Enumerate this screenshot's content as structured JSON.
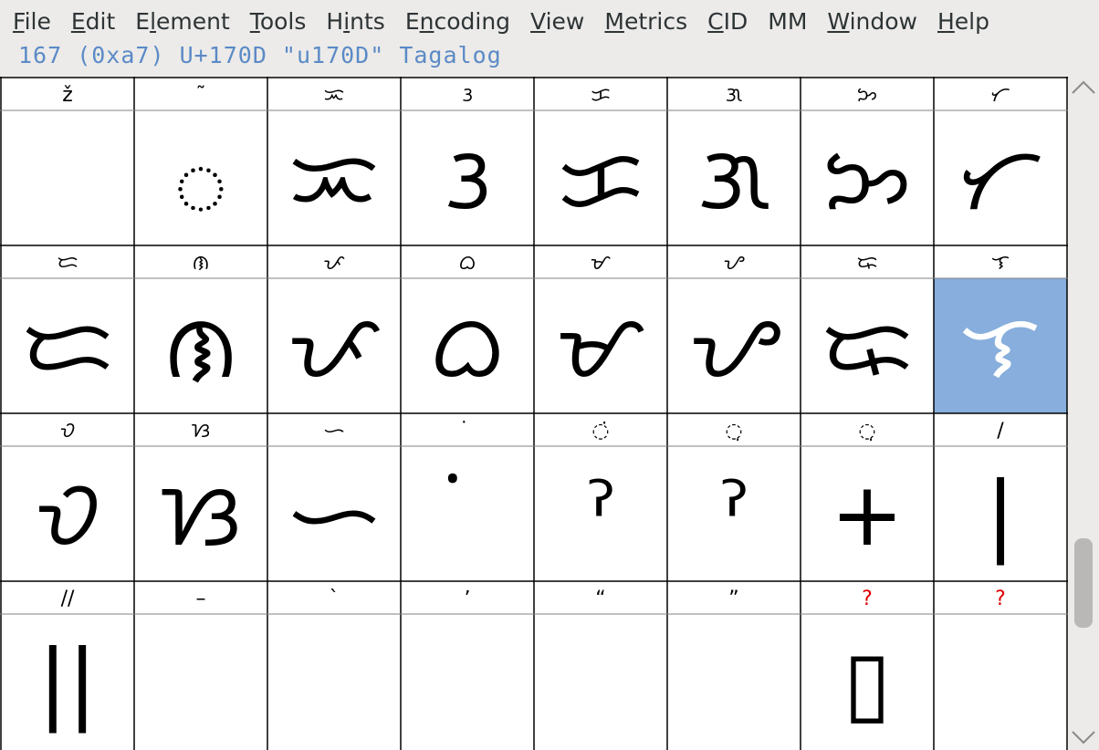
{
  "menu": [
    {
      "key": "file",
      "pre": "",
      "acc": "F",
      "post": "ile"
    },
    {
      "key": "edit",
      "pre": "",
      "acc": "E",
      "post": "dit"
    },
    {
      "key": "element",
      "pre": "E",
      "acc": "l",
      "post": "ement"
    },
    {
      "key": "tools",
      "pre": "",
      "acc": "T",
      "post": "ools"
    },
    {
      "key": "hints",
      "pre": "H",
      "acc": "i",
      "post": "nts"
    },
    {
      "key": "encoding",
      "pre": "E",
      "acc": "n",
      "post": "coding"
    },
    {
      "key": "view",
      "pre": "",
      "acc": "V",
      "post": "iew"
    },
    {
      "key": "metrics",
      "pre": "",
      "acc": "M",
      "post": "etrics"
    },
    {
      "key": "cid",
      "pre": "",
      "acc": "C",
      "post": "ID"
    },
    {
      "key": "mm",
      "pre": "MM",
      "acc": "",
      "post": ""
    },
    {
      "key": "window",
      "pre": "",
      "acc": "W",
      "post": "indow"
    },
    {
      "key": "help",
      "pre": "",
      "acc": "H",
      "post": "elp"
    }
  ],
  "info": "167 (0xa7) U+170D \"u170D\" Tagalog",
  "colors": {
    "info_text": "#5b8ac6",
    "selected_cell": "#87aedc",
    "missing_label": "#dd0000"
  },
  "glyph_rows": [
    [
      {
        "label": "ž",
        "glyph": "",
        "name": "zcaron"
      },
      {
        "label": "˜",
        "glyph": "ᜀ",
        "name": "tagalog-a"
      },
      {
        "label": "ᜁ",
        "glyph": "ᜁ",
        "name": "tagalog-i"
      },
      {
        "label": "ᜂ",
        "glyph": "ᜂ",
        "name": "tagalog-u"
      },
      {
        "label": "ᜃ",
        "glyph": "ᜃ",
        "name": "tagalog-ka"
      },
      {
        "label": "ᜄ",
        "glyph": "ᜄ",
        "name": "tagalog-ga"
      },
      {
        "label": "ᜅ",
        "glyph": "ᜅ",
        "name": "tagalog-nga"
      },
      {
        "label": "ᜆ",
        "glyph": "ᜆ",
        "name": "tagalog-ta"
      }
    ],
    [
      {
        "label": "ᜇ",
        "glyph": "ᜇ",
        "name": "tagalog-da"
      },
      {
        "label": "ᜈ",
        "glyph": "ᜈ",
        "name": "tagalog-na"
      },
      {
        "label": "ᜉ",
        "glyph": "ᜉ",
        "name": "tagalog-pa"
      },
      {
        "label": "ᜊ",
        "glyph": "ᜊ",
        "name": "tagalog-ba"
      },
      {
        "label": "ᜋ",
        "glyph": "ᜋ",
        "name": "tagalog-ma"
      },
      {
        "label": "ᜌ",
        "glyph": "ᜌ",
        "name": "tagalog-ya"
      },
      {
        "label": "ᜍ",
        "glyph": "ᜍ",
        "name": "tagalog-ra"
      },
      {
        "label": "ᜎ",
        "glyph": "ᜎ",
        "name": "tagalog-la",
        "selected": true
      }
    ],
    [
      {
        "label": "ᜏ",
        "glyph": "ᜏ",
        "name": "tagalog-wa"
      },
      {
        "label": "ᜐ",
        "glyph": "ᜐ",
        "name": "tagalog-sa"
      },
      {
        "label": "ᜑ",
        "glyph": "ᜑ",
        "name": "tagalog-ha"
      },
      {
        "label": "ᜒ",
        "glyph": "ᜒ",
        "name": "tagalog-i-sign"
      },
      {
        "label": "◌̇",
        "glyph": "ˀ",
        "name": "tagalog-i-mark"
      },
      {
        "label": "◌̣",
        "glyph": "ˀ",
        "name": "tagalog-u-mark"
      },
      {
        "label": "◌̣",
        "glyph": "+",
        "name": "tagalog-virama"
      },
      {
        "label": "/",
        "glyph": "|",
        "name": "danda"
      }
    ],
    [
      {
        "label": "//",
        "glyph": "||",
        "name": "double-danda"
      },
      {
        "label": "–",
        "glyph": "",
        "name": "endash"
      },
      {
        "label": "`",
        "glyph": "",
        "name": "quoteleft"
      },
      {
        "label": "ʼ",
        "glyph": "",
        "name": "quoteright"
      },
      {
        "label": "“",
        "glyph": "",
        "name": "quotedblleft"
      },
      {
        "label": "”",
        "glyph": "",
        "name": "quotedblright"
      },
      {
        "label": "?",
        "glyph": "▯",
        "name": "missing-1",
        "missing": true
      },
      {
        "label": "?",
        "glyph": "",
        "name": "missing-2",
        "missing": true
      }
    ]
  ]
}
